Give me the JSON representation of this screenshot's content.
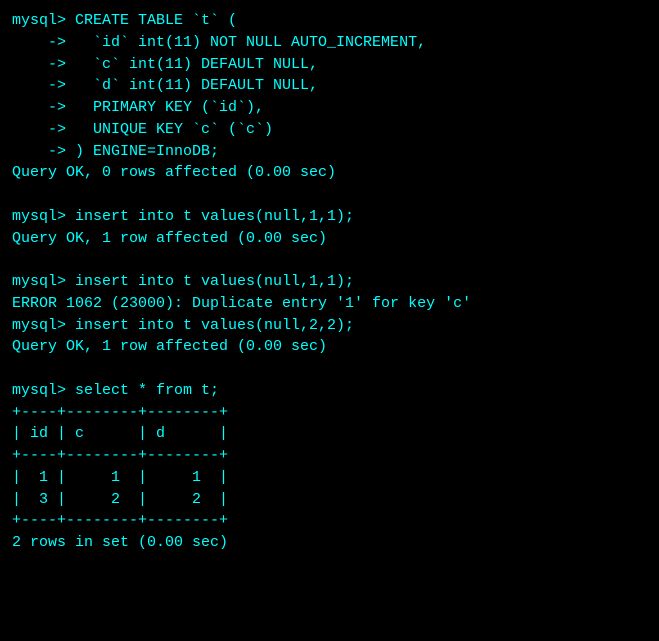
{
  "terminal": {
    "lines": [
      {
        "text": "mysql> CREATE TABLE `t` (",
        "type": "normal"
      },
      {
        "text": "    ->   `id` int(11) NOT NULL AUTO_INCREMENT,",
        "type": "normal"
      },
      {
        "text": "    ->   `c` int(11) DEFAULT NULL,",
        "type": "normal"
      },
      {
        "text": "    ->   `d` int(11) DEFAULT NULL,",
        "type": "normal"
      },
      {
        "text": "    ->   PRIMARY KEY (`id`),",
        "type": "normal"
      },
      {
        "text": "    ->   UNIQUE KEY `c` (`c`)",
        "type": "normal"
      },
      {
        "text": "    -> ) ENGINE=InnoDB;",
        "type": "normal"
      },
      {
        "text": "Query OK, 0 rows affected (0.00 sec)",
        "type": "normal"
      },
      {
        "text": "",
        "type": "blank"
      },
      {
        "text": "mysql> insert into t values(null,1,1);",
        "type": "normal"
      },
      {
        "text": "Query OK, 1 row affected (0.00 sec)",
        "type": "normal"
      },
      {
        "text": "",
        "type": "blank"
      },
      {
        "text": "mysql> insert into t values(null,1,1);",
        "type": "normal"
      },
      {
        "text": "ERROR 1062 (23000): Duplicate entry '1' for key 'c'",
        "type": "normal"
      },
      {
        "text": "mysql> insert into t values(null,2,2);",
        "type": "normal"
      },
      {
        "text": "Query OK, 1 row affected (0.00 sec)",
        "type": "normal"
      },
      {
        "text": "",
        "type": "blank"
      },
      {
        "text": "mysql> select * from t;",
        "type": "normal"
      },
      {
        "text": "+----+--------+--------+",
        "type": "normal"
      },
      {
        "text": "| id | c      | d      |",
        "type": "normal"
      },
      {
        "text": "+----+--------+--------+",
        "type": "normal"
      },
      {
        "text": "|  1 |     1  |     1  |",
        "type": "normal"
      },
      {
        "text": "|  3 |     2  |     2  |",
        "type": "normal"
      },
      {
        "text": "+----+--------+--------+",
        "type": "normal"
      },
      {
        "text": "2 rows in set (0.00 sec)",
        "type": "normal"
      }
    ]
  }
}
